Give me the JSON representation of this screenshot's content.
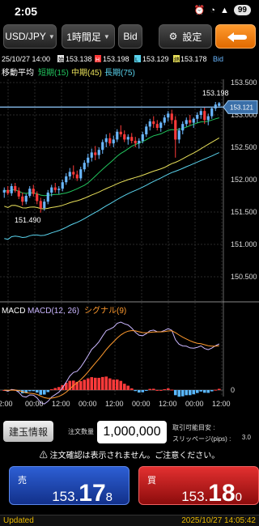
{
  "status_bar": {
    "time": "2:05",
    "battery": "99"
  },
  "toolbar": {
    "pair": "USD/JPY",
    "timeframe": "1時間足",
    "price_side": "Bid",
    "settings_label": "設定"
  },
  "ohlc": {
    "date": "25/10/27 14:00",
    "open_label": "始",
    "open": "153.138",
    "high_label": "H",
    "high": "153.198",
    "low_label": "L",
    "low": "153.129",
    "close_label": "終",
    "close": "153.178",
    "side": "Bid"
  },
  "ma_legend": {
    "title": "移動平均",
    "short": "短期(15)",
    "mid": "中期(45)",
    "long": "長期(75)"
  },
  "macd_legend": {
    "title": "MACD",
    "macd": "MACD(12, 26)",
    "signal": "シグナル(9)"
  },
  "chart_data": {
    "type": "candlestick",
    "y_axis_labels": [
      "153.500",
      "153.000",
      "152.500",
      "152.000",
      "151.500",
      "151.000",
      "150.500"
    ],
    "ylim": [
      150.2,
      153.55
    ],
    "price_high_annotation": "153.198",
    "price_low_annotation": "151.490",
    "current_price_tag": "153.121",
    "current_line_value": 153.121,
    "x_tick_labels": [
      "2:00",
      "00:00",
      "12:00",
      "00:00",
      "12:00",
      "00:00",
      "12:00",
      "00:00",
      "12:00"
    ],
    "macd_zero_label": "0",
    "candles": [
      [
        151.8,
        151.88,
        151.72,
        151.84
      ],
      [
        151.84,
        151.9,
        151.76,
        151.79
      ],
      [
        151.79,
        151.94,
        151.75,
        151.9
      ],
      [
        151.9,
        151.95,
        151.8,
        151.83
      ],
      [
        151.83,
        151.88,
        151.7,
        151.74
      ],
      [
        151.74,
        151.8,
        151.6,
        151.66
      ],
      [
        151.66,
        151.78,
        151.62,
        151.75
      ],
      [
        151.75,
        151.9,
        151.72,
        151.86
      ],
      [
        151.86,
        151.92,
        151.74,
        151.78
      ],
      [
        151.78,
        151.82,
        151.62,
        151.67
      ],
      [
        151.67,
        151.72,
        151.49,
        151.56
      ],
      [
        151.56,
        151.7,
        151.52,
        151.66
      ],
      [
        151.66,
        151.84,
        151.62,
        151.8
      ],
      [
        151.8,
        151.92,
        151.74,
        151.88
      ],
      [
        151.88,
        151.95,
        151.8,
        151.84
      ],
      [
        151.84,
        151.9,
        151.78,
        151.86
      ],
      [
        151.86,
        152.0,
        151.82,
        151.96
      ],
      [
        151.96,
        152.1,
        151.92,
        152.05
      ],
      [
        152.05,
        152.18,
        152.0,
        152.12
      ],
      [
        152.12,
        152.22,
        152.02,
        152.08
      ],
      [
        152.08,
        152.14,
        151.98,
        152.02
      ],
      [
        152.02,
        152.2,
        151.98,
        152.16
      ],
      [
        152.16,
        152.3,
        152.12,
        152.26
      ],
      [
        152.26,
        152.4,
        152.2,
        152.34
      ],
      [
        152.34,
        152.48,
        152.28,
        152.42
      ],
      [
        152.42,
        152.52,
        152.3,
        152.38
      ],
      [
        152.38,
        152.5,
        152.32,
        152.46
      ],
      [
        152.46,
        152.62,
        152.4,
        152.58
      ],
      [
        152.58,
        152.7,
        152.5,
        152.64
      ],
      [
        152.64,
        152.72,
        152.52,
        152.56
      ],
      [
        152.56,
        152.68,
        152.5,
        152.62
      ],
      [
        152.62,
        152.78,
        152.58,
        152.74
      ],
      [
        152.74,
        152.84,
        152.66,
        152.7
      ],
      [
        152.7,
        152.76,
        152.58,
        152.62
      ],
      [
        152.62,
        152.7,
        152.54,
        152.66
      ],
      [
        152.66,
        152.72,
        152.56,
        152.6
      ],
      [
        152.6,
        152.66,
        152.5,
        152.56
      ],
      [
        152.56,
        152.64,
        152.48,
        152.6
      ],
      [
        152.6,
        152.74,
        152.56,
        152.7
      ],
      [
        152.7,
        152.86,
        152.66,
        152.82
      ],
      [
        152.82,
        152.94,
        152.76,
        152.9
      ],
      [
        152.9,
        152.98,
        152.8,
        152.86
      ],
      [
        152.86,
        152.92,
        152.76,
        152.8
      ],
      [
        152.8,
        152.9,
        152.74,
        152.88
      ],
      [
        152.88,
        153.0,
        152.84,
        152.96
      ],
      [
        152.96,
        153.06,
        152.9,
        153.02
      ],
      [
        153.02,
        153.08,
        152.86,
        152.92
      ],
      [
        152.92,
        152.98,
        152.34,
        152.62
      ],
      [
        152.62,
        152.8,
        152.56,
        152.76
      ],
      [
        152.76,
        152.9,
        152.7,
        152.86
      ],
      [
        152.86,
        152.96,
        152.82,
        152.92
      ],
      [
        152.92,
        153.0,
        152.84,
        152.88
      ],
      [
        152.88,
        152.96,
        152.8,
        152.94
      ],
      [
        152.94,
        153.04,
        152.88,
        153.0
      ],
      [
        153.0,
        153.1,
        152.94,
        153.06
      ],
      [
        153.06,
        153.12,
        152.86,
        152.92
      ],
      [
        152.92,
        153.02,
        152.84,
        152.98
      ],
      [
        152.98,
        153.12,
        152.94,
        153.1
      ],
      [
        153.1,
        153.2,
        153.06,
        153.16
      ],
      [
        153.14,
        153.2,
        153.13,
        153.18
      ]
    ]
  },
  "order": {
    "info_button": "建玉情報",
    "qty_label": "注文数量",
    "qty_value": "1,000,000",
    "slippage_line1": "取引可能目安 :",
    "slippage_line2": "スリッページ(pips) :",
    "slippage_value": "3.0"
  },
  "notice": "注文確認は表示されません。ご注意ください。",
  "sell": {
    "label": "売",
    "p1": "153.",
    "p2": "17",
    "p3": "8"
  },
  "buy": {
    "label": "買",
    "p1": "153.",
    "p2": "18",
    "p3": "0"
  },
  "footer": {
    "status": "Updated",
    "timestamp": "2025/10/27 14:05:42"
  },
  "colors": {
    "short_ma": "#22c55e",
    "mid_ma": "#e8e05a",
    "long_ma": "#5ad4ee",
    "bull": "#6ab7ff",
    "bear": "#ff3a3a",
    "macd": "#cbb7ff",
    "signal": "#ff9a2e"
  }
}
